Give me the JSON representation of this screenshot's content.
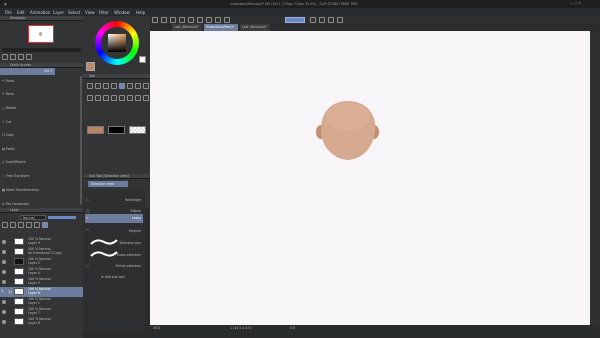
{
  "window": {
    "title": "Illustration(Remove)* (60 (5x) 1 (720px 720px 35.0%) - CLIP STUDIO PAINT PRO",
    "colors": {
      "accent": "#6a88c8",
      "selected": "#6b7c9c",
      "canvas": "#f7f5f7"
    }
  },
  "menu": [
    "File",
    "Edit",
    "Animation",
    "Layer",
    "Select",
    "View",
    "Filter",
    "Window",
    "Help"
  ],
  "tabs": [
    "Last (Remove)*",
    "Illustration(Rem)*",
    "Last (Remove)*"
  ],
  "navigator": {
    "title": "Navigator",
    "zoom": "35.0"
  },
  "quick_access": {
    "title": "Quick Access",
    "set": "Set 2",
    "items": [
      "Undo",
      "Redo",
      "Delete",
      "Cut",
      "Copy",
      "Paste",
      "Scale/Rotate",
      "Free Transform",
      "Mesh Transformation",
      "Flip Horizontal"
    ]
  },
  "tool_palette": {
    "title": "Tool"
  },
  "sub_tool": {
    "title": "Sub Tool [Selection area]",
    "tab": "Selection area",
    "items": [
      "Rectangle",
      "Ellipse",
      "Lasso",
      "Polyline",
      "Selection pen",
      "Erase selection",
      "Shrink selection"
    ],
    "selected": "Lasso",
    "add_label": "Add sub tool"
  },
  "layer_panel": {
    "title": "Layer",
    "blend": "Normal",
    "opacity": "100",
    "layers": [
      {
        "pct": "100 % Normal",
        "name": "Layer 9"
      },
      {
        "pct": "100 % Normal",
        "name": "for thumbnail 3 Copy"
      },
      {
        "pct": "100 % Normal",
        "name": "Layer 2"
      },
      {
        "pct": "100 % Normal",
        "name": "Layer 4"
      },
      {
        "pct": "100 % Normal",
        "name": "Layer 5"
      },
      {
        "pct": "100 % Normal",
        "name": "Layer 6"
      },
      {
        "pct": "100 % Normal",
        "name": "Layer 1"
      },
      {
        "pct": "100 % Normal",
        "name": "Layer 7"
      },
      {
        "pct": "100 % Normal",
        "name": "Layer 8"
      }
    ],
    "selected_index": 5
  },
  "status": {
    "zoom": "35.0",
    "coords": "1 (19.2 x 3.5)",
    "angle": "0.0"
  }
}
